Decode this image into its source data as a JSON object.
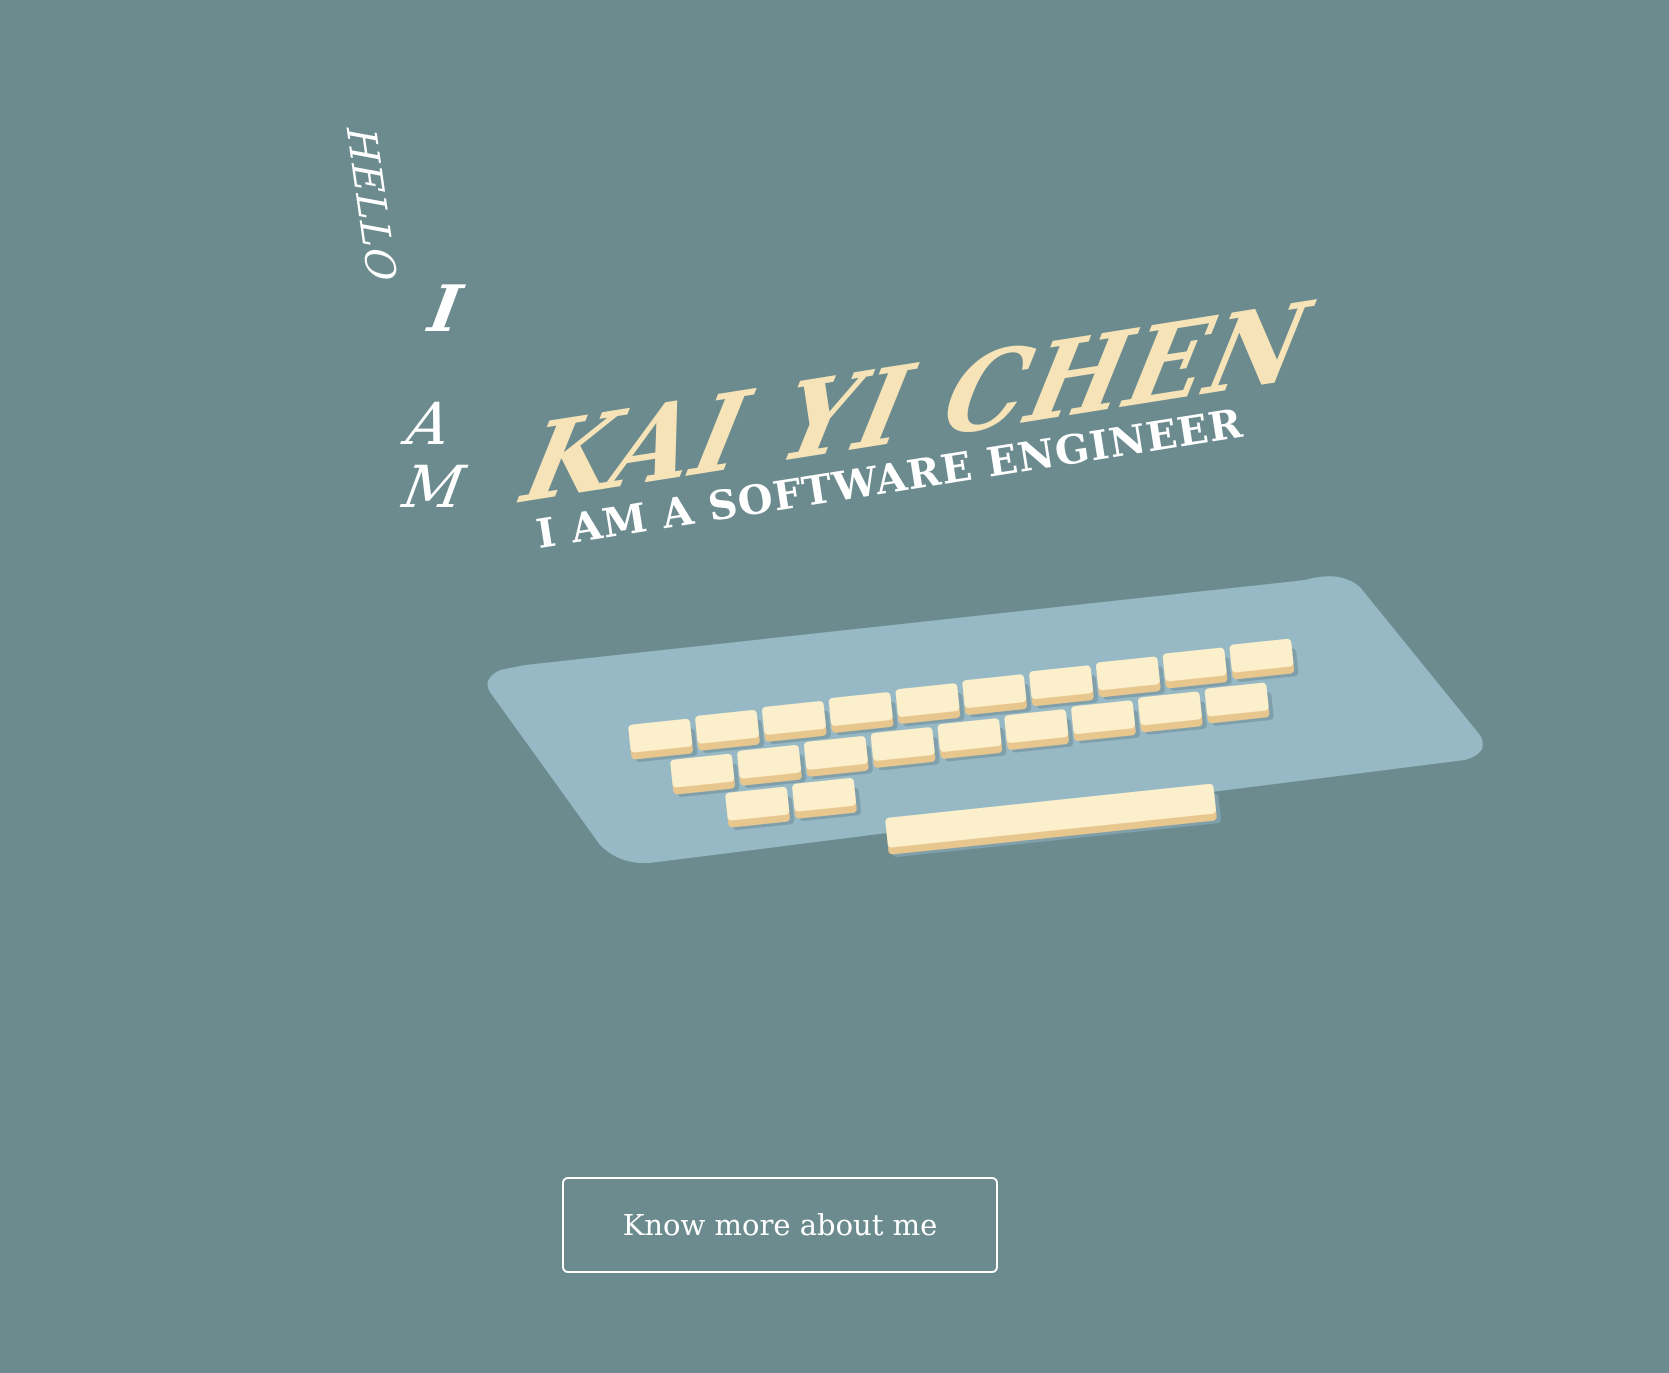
{
  "hero": {
    "hello": "HELLO",
    "i": "I",
    "a": "A",
    "m": "M",
    "name": "KAI YI CHEN",
    "role": "I AM A SOFTWARE ENGINEER"
  },
  "cta": {
    "label": "Know more about me"
  },
  "colors": {
    "background": "#6b8b8e",
    "name_accent": "#f7e3b8",
    "keyboard_base": "#97b9c5",
    "key_top": "#fbefcc",
    "key_side": "#e8c78e"
  }
}
